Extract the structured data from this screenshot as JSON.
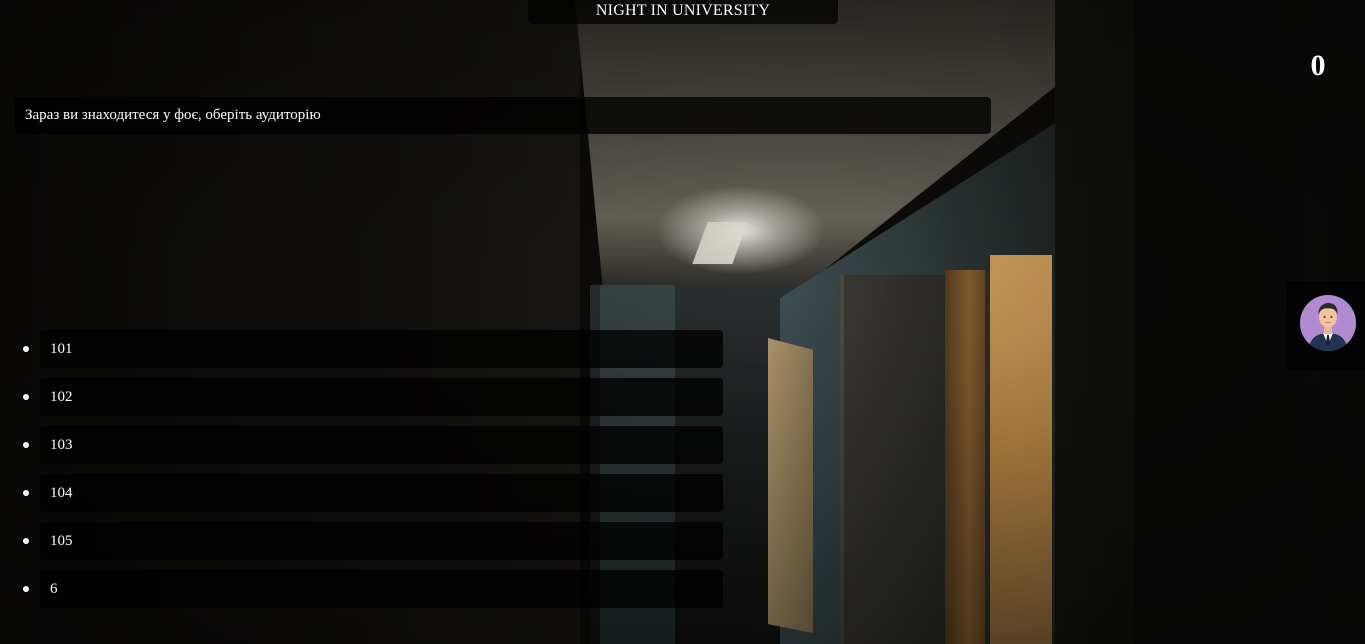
{
  "game": {
    "title": "NIGHT IN UNIVERSITY",
    "score": "0"
  },
  "dialog": {
    "message": "Зараз ви знаходитеся у фоє, оберіть аудиторію"
  },
  "choices": [
    {
      "label": "101"
    },
    {
      "label": "102"
    },
    {
      "label": "103"
    },
    {
      "label": "104"
    },
    {
      "label": "105"
    },
    {
      "label": "6"
    }
  ],
  "character": {
    "icon": "person-in-suit-icon",
    "avatar_bg": "#b18bd1"
  }
}
